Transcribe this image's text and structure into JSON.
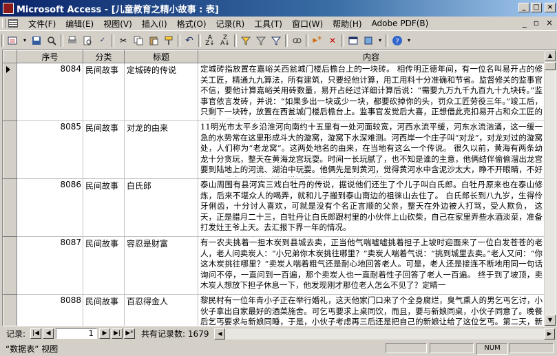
{
  "window": {
    "title": "Microsoft Access - [儿童教育之精小故事 : 表]"
  },
  "menu": {
    "items": [
      "文件(F)",
      "编辑(E)",
      "视图(V)",
      "插入(I)",
      "格式(O)",
      "记录(R)",
      "工具(T)",
      "窗口(W)",
      "帮助(H)",
      "Adobe PDF(B)"
    ],
    "right": [
      "_",
      "▫",
      "×"
    ]
  },
  "toolbar": {
    "icons": [
      "view-icon",
      "save-icon",
      "search-icon",
      "print-icon",
      "print-preview-icon",
      "spelling-icon",
      "cut-icon",
      "copy-icon",
      "paste-icon",
      "format-painter-icon",
      "undo-icon",
      "sort-ascending-icon",
      "sort-descending-icon",
      "filter-by-selection-icon",
      "filter-by-form-icon",
      "apply-filter-icon",
      "find-icon",
      "new-record-icon",
      "delete-record-icon",
      "database-window-icon",
      "new-object-icon",
      "help-icon"
    ]
  },
  "table": {
    "columns": [
      "序号",
      "分类",
      "标题",
      "内容"
    ],
    "rows": [
      {
        "id": "8084",
        "category": "民间故事",
        "title": "定城砖的传说",
        "content": "定城砖指放置在嘉峪关西瓮城门楼后檐台上的一块砖。 相传明正德年间，有一位名叫易开占的修关工匠，精通九九算法，所有建筑，只要经他计算，用工用料十分准确和节省。监督修关的监事官不信，要他计算嘉峪关用砖数量，易开占经过详细计算后说：“需要九万九千九百九十九块砖。”监事官依言发砖，并说：“如果多出一块或少一块，都要砍掉你的头，罚众工匠劳役三年。”竣工后，只剩下一块砖，放置在西瓮城门楼后檐台上。监事官发觉后大喜，正想借此克扣易开占和众工匠的工钱，哪知易开占不慌不忙的"
      },
      {
        "id": "8085",
        "category": "民间故事",
        "title": "对龙的由来",
        "content": "11明光市太平乡沿淮河向南约十五里有一处河面较宽，河西水流平缓，河东水流汹涌，这一缓一急的水势常在这里形成斗大的漩窝，漩窝下水深难测。河西岸一个庄子叫“对龙”，对龙对过的漩窝处，人们称为“老龙窝”。这两处地名的由来，在当地有这么一个传说。 很久以前，黄海有两条幼龙十分贪玩，整天在黄海龙宫玩耍。时间一长玩腻了，也不知是谁的主意，他俩结伴偷偷溜出龙宫要到陆地上的河流、湖泊中玩耍。他俩先是到黄河，觉得黄河水中含泥沙太大，睁不开眼睛，不好玩，于是来到了洪泽湖。洪泽湖可是一大好去处，湖面"
      },
      {
        "id": "8086",
        "category": "民间故事",
        "title": "白氏郎",
        "content": "泰山周围有县河宾三戏白牡丹的传说，据说他们还生了个儿子叫白氏郎。白牡丹原来也在泰山修炼，后来不堪众人的喝弄，就和儿子搬到泰山南边的祖徕山去住了。 白氏郎长到八九岁，生得伶牙俐齿，十分讨人喜欢，可就是没有个名正言顺的父亲，整天在外边被人打骂，受人欺负， 这天，正是腊月二十三，白牡丹让白氏郎跟村里的小伙伴上山砍柴，自己在家里弄些水酒淡菜，准备打发灶王爷上天。去汇报下界一年的情况。"
      },
      {
        "id": "8087",
        "category": "民间故事",
        "title": "容忍是财富",
        "content": "有一农夫挑着一担木炭到县城去卖，正当他气喘嘘嘘挑着担子上坡时迎面来了一位白发苍苍的老人，老人问卖炭人：“小兄弟你木炭挑往哪里？”卖炭人喘着气说：“挑到城里去卖。”老人又问：“你这木炭挑往哪里？”卖炭人喘着粗气还是耐心地回答老人。可是，老人还是接连不断地用同一句话询问不停，一直问到一百遍，那个卖炭人也一直耐着性子回答了老人一百遍。 终于到了坡顶，卖木炭人想放下担子休息一下，他发现刚才那位老人怎么不见了？定睛一"
      },
      {
        "id": "8088",
        "category": "民间故事",
        "title": "百忍得金人",
        "content": "黎民村有一位年青小子正在举行婚礼，这天他家门口来了个全身腐烂，臭气熏人的男乞丐乞讨，小伙子拿出自家最好的酒菜施舍。可乞丐要求上桌同饮，而且，要与新娘同桌，小伙子同意了。晚餐后乞丐要求与新娘同睡，于是，小伙子考虑再三后还是把自己的新娘让给了这位乞丐。第二天，新娘醒来时，发现自己怀里抱着一个金人。当地一时传开了这件事……"
      }
    ]
  },
  "navigation": {
    "label": "记录:",
    "current": "1",
    "total_label": "共有记录数:",
    "total": "1679"
  },
  "status": {
    "view": "“数据表” 视图",
    "num": "NUM"
  }
}
